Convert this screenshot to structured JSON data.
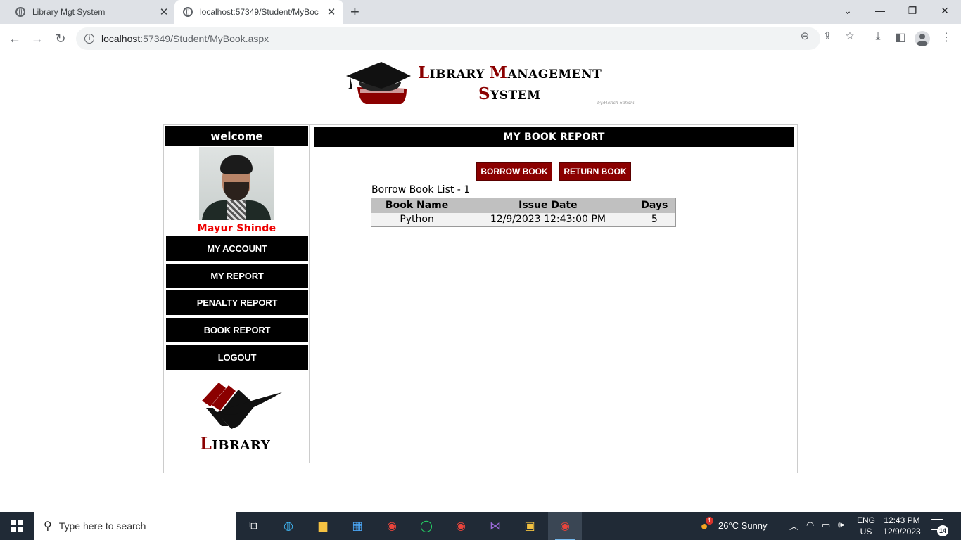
{
  "browser": {
    "tabs": [
      {
        "title": "Library Mgt System",
        "active": false
      },
      {
        "title": "localhost:57349/Student/MyBoc",
        "active": true
      }
    ],
    "new_tab_icon": "plus-icon",
    "address": {
      "host": "localhost",
      "rest": ":57349/Student/MyBook.aspx"
    }
  },
  "header": {
    "title_line1_cap": "L",
    "title_line1_a": "IBRARY ",
    "title_line1_cap2": "M",
    "title_line1_b": "ANAGEMENT",
    "title_line2_cap": "S",
    "title_line2_rest": "YSTEM",
    "byline": "by:Harish Sahani"
  },
  "sidebar": {
    "welcome": "welcome",
    "student_name": "Mayur Shinde",
    "menu": [
      {
        "label": "MY ACCOUNT"
      },
      {
        "label": "MY REPORT"
      },
      {
        "label": "PENALTY REPORT"
      },
      {
        "label": "BOOK REPORT"
      },
      {
        "label": "LOGOUT"
      }
    ],
    "logo_cap": "L",
    "logo_rest": "IBRARY"
  },
  "main": {
    "title": "MY BOOK REPORT",
    "borrow_button": "BORROW BOOK",
    "return_button": "RETURN BOOK",
    "list_caption": "Borrow Book List - 1",
    "table": {
      "headers": [
        "Book Name",
        "Issue Date",
        "Days"
      ],
      "rows": [
        [
          "Python",
          "12/9/2023 12:43:00 PM",
          "5"
        ]
      ]
    }
  },
  "taskbar": {
    "search_placeholder": "Type here to search",
    "weather": "26°C  Sunny",
    "weather_badge": "1",
    "lang_line1": "ENG",
    "lang_line2": "US",
    "time": "12:43 PM",
    "date": "12/9/2023",
    "notification_count": "14"
  },
  "colors": {
    "brand_red": "#8b0000",
    "name_red": "#ee0000",
    "menu_black": "#000000"
  }
}
